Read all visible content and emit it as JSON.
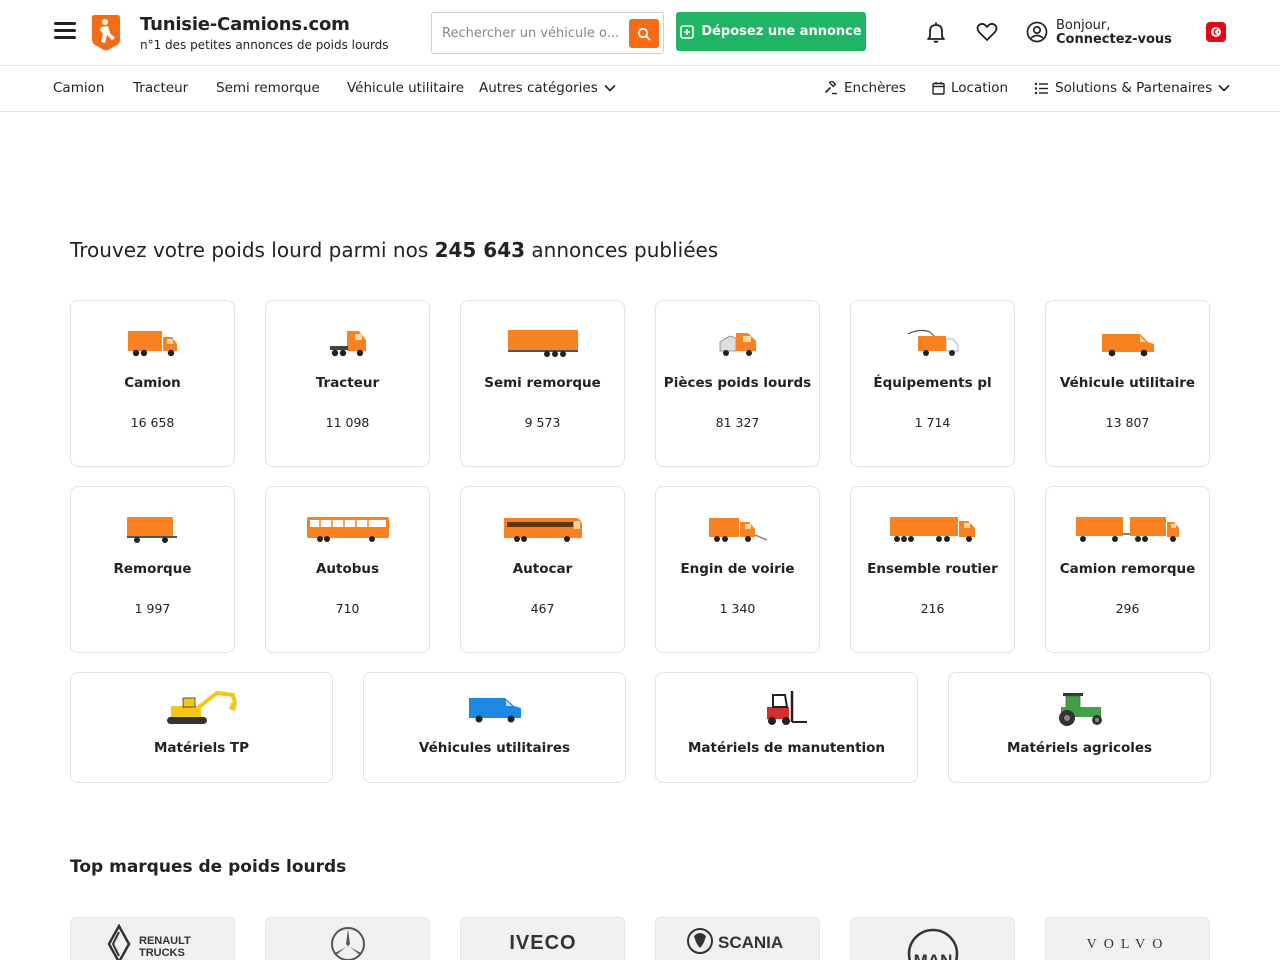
{
  "header": {
    "brand_title": "Tunisie-Camions.com",
    "brand_subtitle": "n°1 des petites annonces de poids lourds",
    "search_placeholder": "Rechercher un véhicule o...",
    "post_button": "Déposez une annonce",
    "greeting": "Bonjour,",
    "login": "Connectez-vous",
    "icons": [
      "menu-icon",
      "logo-icon",
      "search-icon",
      "bell-icon",
      "heart-icon",
      "user-icon",
      "tunisia-flag-icon"
    ],
    "accent_color": "#f76b15",
    "post_button_color": "#1fb564"
  },
  "nav": {
    "left": [
      "Camion",
      "Tracteur",
      "Semi remorque",
      "Véhicule utilitaire",
      "Autres catégories"
    ],
    "right": [
      "Enchères",
      "Location",
      "Solutions & Partenaires"
    ]
  },
  "headline": {
    "prefix": "Trouvez votre poids lourd parmi nos",
    "count": "245 643",
    "suffix": "annonces publiées"
  },
  "categories": [
    {
      "name": "Camion",
      "count": "16 658"
    },
    {
      "name": "Tracteur",
      "count": "11 098"
    },
    {
      "name": "Semi remorque",
      "count": "9 573"
    },
    {
      "name": "Pièces poids lourds",
      "count": "81 327"
    },
    {
      "name": "Équipements pl",
      "count": "1 714"
    },
    {
      "name": "Véhicule utilitaire",
      "count": "13 807"
    },
    {
      "name": "Remorque",
      "count": "1 997"
    },
    {
      "name": "Autobus",
      "count": "710"
    },
    {
      "name": "Autocar",
      "count": "467"
    },
    {
      "name": "Engin de voirie",
      "count": "1 340"
    },
    {
      "name": "Ensemble routier",
      "count": "216"
    },
    {
      "name": "Camion remorque",
      "count": "296"
    }
  ],
  "other_sites": [
    "Matériels TP",
    "Véhicules utilitaires",
    "Matériels de manutention",
    "Matériels agricoles"
  ],
  "brands": {
    "title": "Top marques de poids lourds",
    "items": [
      "RENAULT TRUCKS",
      "Mercedes",
      "IVECO",
      "SCANIA",
      "MAN",
      "VOLVO"
    ]
  }
}
